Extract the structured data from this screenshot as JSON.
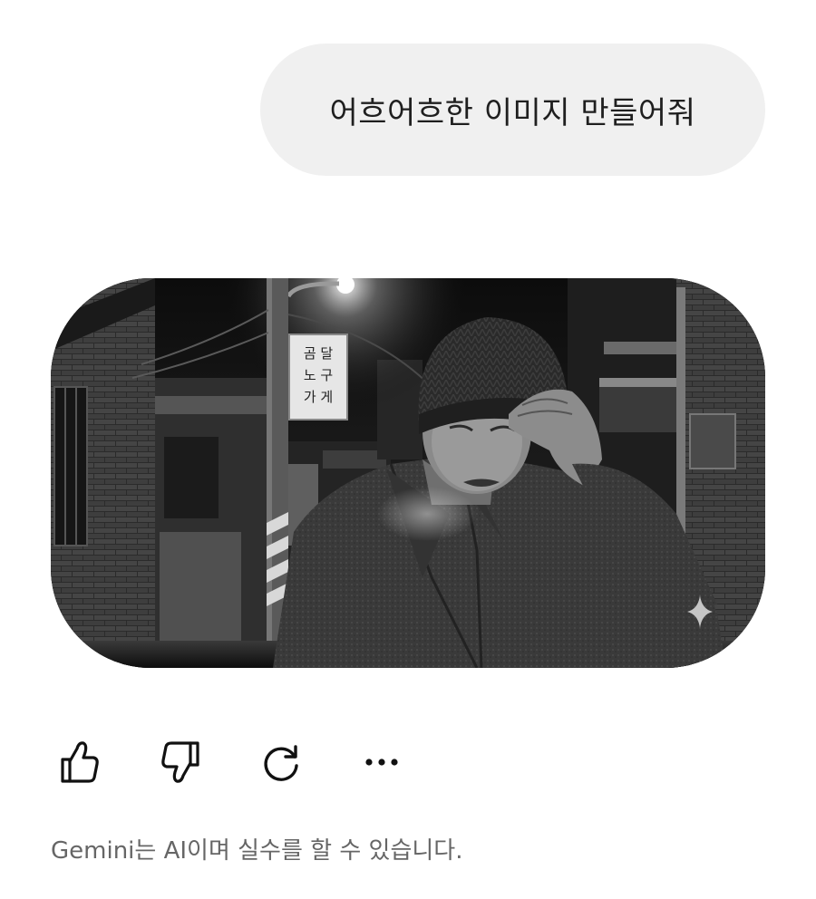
{
  "conversation": {
    "user_message": "어흐어흐한 이미지 만들어줘"
  },
  "response": {
    "image": {
      "sign_text": [
        "곰 달",
        "노 구",
        "가 게"
      ]
    },
    "actions": [
      {
        "name": "thumbs-up-icon",
        "label": "좋아요"
      },
      {
        "name": "thumbs-down-icon",
        "label": "싫어요"
      },
      {
        "name": "regenerate-icon",
        "label": "다시 생성"
      },
      {
        "name": "more-options-icon",
        "label": "더보기"
      }
    ]
  },
  "footer": {
    "disclaimer": "Gemini는 AI이며 실수를 할 수 있습니다."
  }
}
